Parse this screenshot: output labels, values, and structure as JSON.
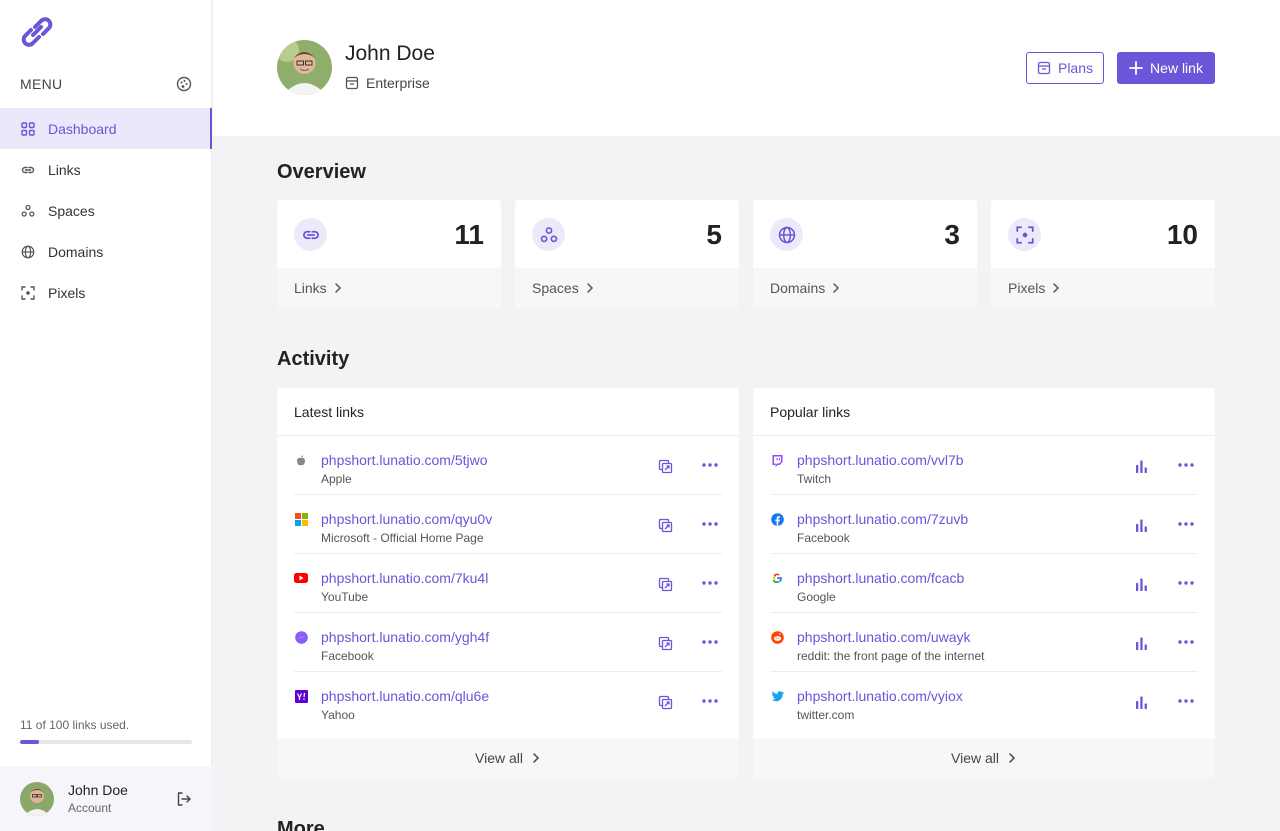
{
  "sidebar": {
    "menu_title": "MENU",
    "items": [
      {
        "label": "Dashboard",
        "icon": "dashboard-icon",
        "active": true
      },
      {
        "label": "Links",
        "icon": "link-icon"
      },
      {
        "label": "Spaces",
        "icon": "spaces-icon"
      },
      {
        "label": "Domains",
        "icon": "domains-icon"
      },
      {
        "label": "Pixels",
        "icon": "pixels-icon"
      }
    ],
    "usage": {
      "text": "11 of 100 links used.",
      "fraction": 0.11
    },
    "account": {
      "name": "John Doe",
      "sub": "Account"
    }
  },
  "header": {
    "name": "John Doe",
    "plan": "Enterprise",
    "plans_button": "Plans",
    "new_link_button": "New link"
  },
  "overview": {
    "title": "Overview",
    "cards": [
      {
        "label": "Links",
        "value": "11",
        "icon": "link-icon"
      },
      {
        "label": "Spaces",
        "value": "5",
        "icon": "spaces-icon"
      },
      {
        "label": "Domains",
        "value": "3",
        "icon": "domains-icon"
      },
      {
        "label": "Pixels",
        "value": "10",
        "icon": "pixels-icon"
      }
    ]
  },
  "activity": {
    "title": "Activity",
    "latest": {
      "title": "Latest links",
      "view_all": "View all",
      "rows": [
        {
          "url": "phpshort.lunatio.com/5tjwo",
          "title": "Apple",
          "favicon": "apple-icon"
        },
        {
          "url": "phpshort.lunatio.com/qyu0v",
          "title": "Microsoft - Official Home Page",
          "favicon": "microsoft-icon"
        },
        {
          "url": "phpshort.lunatio.com/7ku4l",
          "title": "YouTube",
          "favicon": "youtube-icon"
        },
        {
          "url": "phpshort.lunatio.com/ygh4f",
          "title": "Facebook",
          "favicon": "messenger-icon"
        },
        {
          "url": "phpshort.lunatio.com/qlu6e",
          "title": "Yahoo",
          "favicon": "yahoo-icon"
        }
      ]
    },
    "popular": {
      "title": "Popular links",
      "view_all": "View all",
      "rows": [
        {
          "url": "phpshort.lunatio.com/vvl7b",
          "title": "Twitch",
          "favicon": "twitch-icon"
        },
        {
          "url": "phpshort.lunatio.com/7zuvb",
          "title": "Facebook",
          "favicon": "facebook-icon"
        },
        {
          "url": "phpshort.lunatio.com/fcacb",
          "title": "Google",
          "favicon": "google-icon"
        },
        {
          "url": "phpshort.lunatio.com/uwayk",
          "title": "reddit: the front page of the internet",
          "favicon": "reddit-icon"
        },
        {
          "url": "phpshort.lunatio.com/vyiox",
          "title": "twitter.com",
          "favicon": "twitter-icon"
        }
      ]
    }
  },
  "more": {
    "title": "More"
  },
  "colors": {
    "accent": "#6b55d8",
    "accent_light": "#ece9fb"
  }
}
